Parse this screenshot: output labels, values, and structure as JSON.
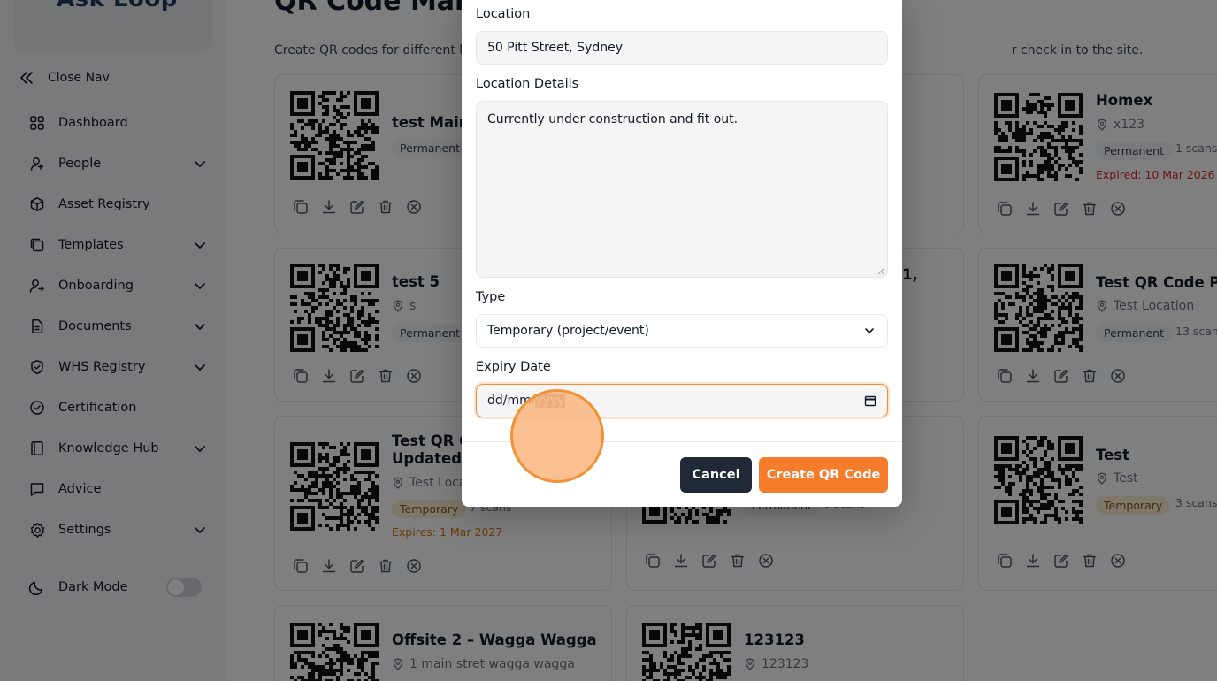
{
  "app": {
    "logo_text": "Ask Loop"
  },
  "sidebar": {
    "close_nav": "Close Nav",
    "items": [
      {
        "label": "Dashboard",
        "icon": "dashboard-icon",
        "has_chevron": false
      },
      {
        "label": "People",
        "icon": "person-icon",
        "has_chevron": true
      },
      {
        "label": "Asset Registry",
        "icon": "box-icon",
        "has_chevron": false
      },
      {
        "label": "Templates",
        "icon": "templates-icon",
        "has_chevron": true
      },
      {
        "label": "Onboarding",
        "icon": "onboarding-icon",
        "has_chevron": true
      },
      {
        "label": "Documents",
        "icon": "document-icon",
        "has_chevron": true
      },
      {
        "label": "WHS Registry",
        "icon": "shield-check-icon",
        "has_chevron": true
      },
      {
        "label": "Certification",
        "icon": "check-circle-icon",
        "has_chevron": false
      },
      {
        "label": "Knowledge Hub",
        "icon": "book-icon",
        "has_chevron": true
      },
      {
        "label": "Advice",
        "icon": "chat-icon",
        "has_chevron": false
      },
      {
        "label": "Settings",
        "icon": "gear-icon",
        "has_chevron": true
      }
    ],
    "dark_mode": {
      "label": "Dark Mode",
      "enabled": false
    }
  },
  "main": {
    "title": "QR Code Mana",
    "description": "Create QR codes for different lo",
    "description_end": "r check in to the site.",
    "cards": [
      {
        "title": "test Main",
        "badge": "Permanent"
      },
      {
        "title": "Homex",
        "location": "x123",
        "badge": "Permanent",
        "scans": "1 scans",
        "expiry": "Expired: 10 Mar 2026"
      },
      {
        "title": "test 5",
        "location": "s",
        "badge": "Permanent"
      },
      {
        "title_fragment": "1,"
      },
      {
        "title": "Test QR Code Perr",
        "location": "Test Location",
        "badge": "Permanent",
        "scans": "13 scans"
      },
      {
        "title_line1": "Test QR Co",
        "title_line2": "Updated",
        "location": "Test Loca",
        "badge": "Temporary",
        "scans": "7 scans",
        "expiry": "Expires: 1 Mar 2027"
      },
      {
        "badge": "Permanent",
        "scans": "0 scans"
      },
      {
        "title": "Test",
        "location": "Test",
        "badge": "Temporary",
        "scans": "3 scans"
      },
      {
        "title": "Offsite 2 – Wagga Wagga",
        "location": "1 main stret wagga wagga"
      },
      {
        "title": "123123",
        "location": "123123"
      }
    ]
  },
  "modal": {
    "location_label": "Location",
    "location_value": "50 Pitt Street, Sydney",
    "details_label": "Location Details",
    "details_value": "Currently under construction and fit out.",
    "type_label": "Type",
    "type_value": "Temporary (project/event)",
    "expiry_label": "Expiry Date",
    "expiry_placeholder_part1": "dd/mm/",
    "expiry_placeholder_part2": "yyyy",
    "cancel_label": "Cancel",
    "create_label": "Create QR Code"
  },
  "colors": {
    "accent": "#f57c2b",
    "dark_button": "#1f2937",
    "expired": "#dc2626",
    "expires": "#d97706"
  }
}
